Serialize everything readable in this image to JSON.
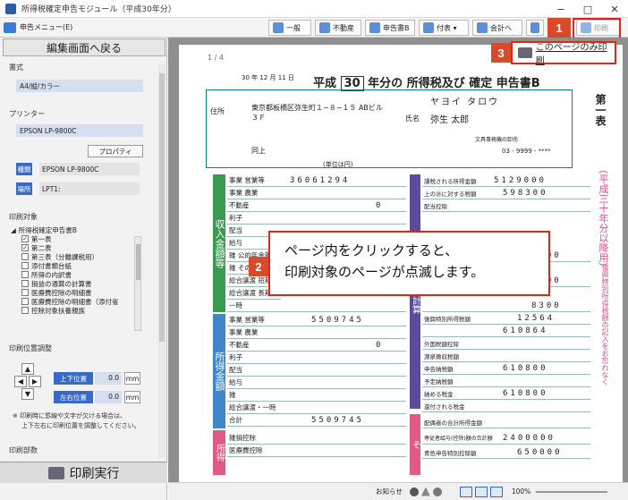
{
  "window": {
    "title": "所得税確定申告モジュール（平成30年分）",
    "buttons": [
      "−",
      "□",
      "✕"
    ]
  },
  "toolbar": {
    "menu_label": "申告メニュー(E)",
    "buttons": [
      "一般",
      "不動産",
      "申告書B",
      "付表 ▾",
      "会計へ",
      "印刷"
    ]
  },
  "annotations": {
    "badge1": "1",
    "badge2": "2",
    "badge3": "3",
    "this_page_print": "このページのみ印刷",
    "callout_line1": "ページ内をクリックすると、",
    "callout_line2": "印刷対象のページが点滅します。"
  },
  "left": {
    "back_button": "編集画面へ戻る",
    "format_title": "書式",
    "format_value": "A4/縦/カラー",
    "printer_title": "プリンター",
    "printer_value": "EPSON LP-9800C",
    "property_button": "プロパティ",
    "kind_label": "種類",
    "kind_value": "EPSON LP-9800C",
    "place_label": "場所",
    "place_value": "LPT1:",
    "print_target_title": "印刷対象",
    "tree": [
      {
        "label": "所得税確定申告書B",
        "checked": null
      },
      {
        "label": "第一表",
        "checked": true
      },
      {
        "label": "第二表",
        "checked": true
      },
      {
        "label": "第三表（分離課税用）",
        "checked": false
      },
      {
        "label": "添付書類台紙",
        "checked": false
      },
      {
        "label": "所得の内訳書",
        "checked": false
      },
      {
        "label": "損益の通算の計算書",
        "checked": false
      },
      {
        "label": "医療費控除の明細書",
        "checked": false
      },
      {
        "label": "医療費控除の明細書（添付省",
        "checked": false
      },
      {
        "label": "控除対象扶養親族",
        "checked": false
      }
    ],
    "position_title": "印刷位置調整",
    "up_down_label": "上下位置",
    "up_down_value": "0.0",
    "left_right_label": "左右位置",
    "left_right_value": "0.0",
    "unit": "mm",
    "note_line1": "※ 印刷時に罫線や文字が欠ける場合は、",
    "note_line2": "上下左右に印刷位置を調整してください。",
    "copies_title": "印刷部数",
    "exec_button": "印刷実行"
  },
  "document": {
    "pager": "1 / 4",
    "era": "平成",
    "year": "30",
    "title_suffix": "年分の 所得税及び 確定 申告書B",
    "date": "30 年 12 月 11 日",
    "address_label": "住所",
    "address": "東京都板橋区弥生町１−８−１５ ABビル３Ｆ",
    "furigana": "ヤヨイ タロウ",
    "name_label": "氏名",
    "name": "弥生 太郎",
    "office": "文具事務機の卸売",
    "phone": "03 - 9999 - ****",
    "same_label": "同上",
    "unit_label": "(単位は円)",
    "side_title": "第一表",
    "side_pink": "(平成三十年分以降用)",
    "side_pink2": "復興特別所得税額の記入をお忘れなく",
    "income_block": "収入金額等",
    "income_rows": [
      {
        "label": "事業 営業等",
        "value": "36061294"
      },
      {
        "label": "事業 農業",
        "value": ""
      },
      {
        "label": "不動産",
        "value": "0"
      },
      {
        "label": "利子",
        "value": ""
      },
      {
        "label": "配当",
        "value": ""
      },
      {
        "label": "給与",
        "value": ""
      },
      {
        "label": "雑 公的年金等",
        "value": ""
      },
      {
        "label": "雑 その他",
        "value": ""
      },
      {
        "label": "総合譲渡 短期",
        "value": ""
      },
      {
        "label": "総合譲渡 長期",
        "value": ""
      },
      {
        "label": "一時",
        "value": ""
      }
    ],
    "shotoku_block": "所得金額",
    "shotoku_rows": [
      {
        "label": "事業 営業等",
        "value": "5509745"
      },
      {
        "label": "事業 農業",
        "value": ""
      },
      {
        "label": "不動産",
        "value": "0"
      },
      {
        "label": "利子",
        "value": ""
      },
      {
        "label": "配当",
        "value": ""
      },
      {
        "label": "給与",
        "value": ""
      },
      {
        "label": "雑",
        "value": ""
      },
      {
        "label": "総合譲渡・一時",
        "value": ""
      },
      {
        "label": "合計",
        "value": "5509745"
      }
    ],
    "deduction_block": "所得",
    "deduction_rows": [
      {
        "label": "雑損控除",
        "value": ""
      },
      {
        "label": "医療費控除",
        "value": ""
      }
    ],
    "tax_block": "税金の計算",
    "tax_rows": [
      {
        "label": "課税される所得金額",
        "value": "5129000"
      },
      {
        "label": "上の㉖に対する税額",
        "value": "598300"
      },
      {
        "label": "配当控除",
        "value": ""
      },
      {
        "label": "",
        "value": ""
      },
      {
        "label": "",
        "value": ""
      },
      {
        "label": "",
        "value": "8300"
      },
      {
        "label": "",
        "value": "8300"
      },
      {
        "label": "",
        "value": "8300"
      },
      {
        "label": "復興特別所得税額",
        "value": "12564"
      },
      {
        "label": "",
        "value": "610864"
      },
      {
        "label": "外国税額控除",
        "value": ""
      },
      {
        "label": "源泉徴収税額",
        "value": ""
      },
      {
        "label": "申告納税額",
        "value": "610800"
      },
      {
        "label": "予定納税額",
        "value": ""
      },
      {
        "label": "納める税金",
        "value": "610800"
      },
      {
        "label": "還付される税金",
        "value": ""
      }
    ],
    "other_block": "そ",
    "other_rows": [
      {
        "label": "配偶者の合計所得金額",
        "value": ""
      },
      {
        "label": "専従者給与(控除)額の合計額",
        "value": "2400000"
      },
      {
        "label": "青色申告特別控除額",
        "value": "650000"
      }
    ]
  },
  "status": {
    "notice": "お知らせ",
    "zoom": "100%"
  }
}
